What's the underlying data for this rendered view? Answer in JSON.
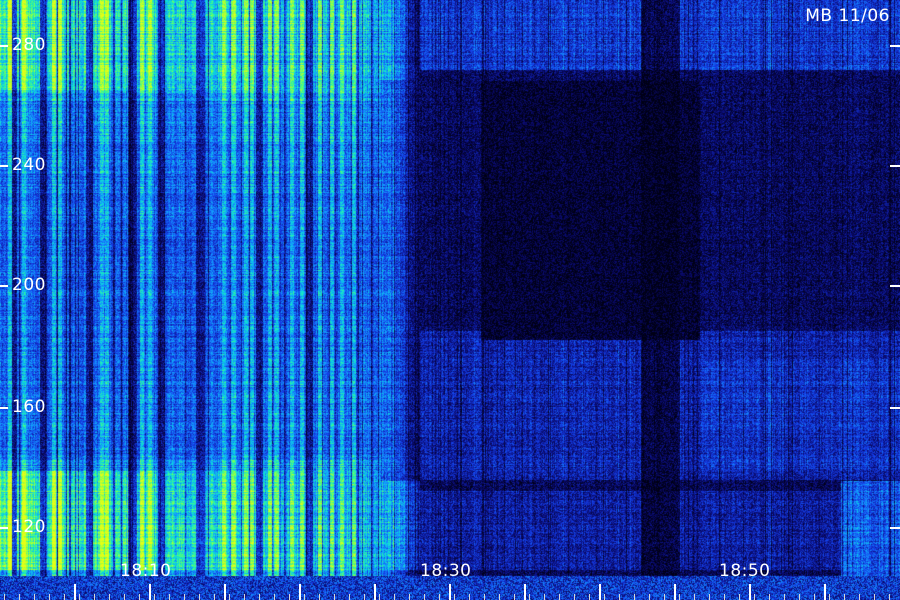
{
  "stamp": "MB 11/06",
  "y_labels": [
    "280",
    "240",
    "200",
    "160",
    "120"
  ],
  "x_labels": [
    "18:10",
    "18:30",
    "18:50"
  ],
  "colors": {
    "background": "#000000",
    "low": "#0a0a6a",
    "mid": "#1e90ff",
    "high": "#00e4c8",
    "peak": "#7cff3a",
    "max": "#c8ff20"
  }
}
